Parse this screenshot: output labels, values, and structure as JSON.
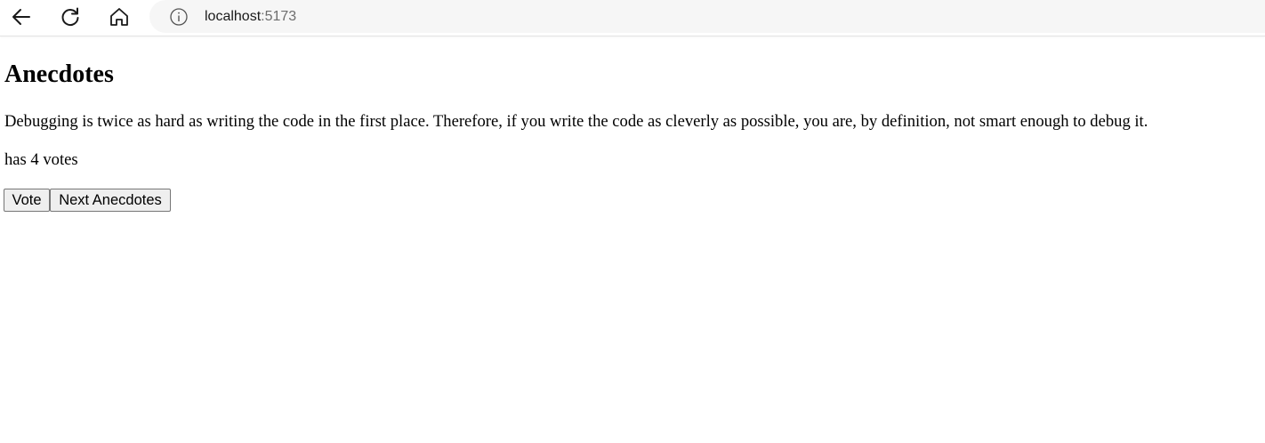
{
  "browser": {
    "back_icon": "back-arrow-icon",
    "reload_icon": "reload-icon",
    "home_icon": "home-icon",
    "info_icon": "info-icon",
    "url_host": "localhost",
    "url_port": ":5173"
  },
  "app": {
    "title": "Anecdotes",
    "anecdote": "Debugging is twice as hard as writing the code in the first place. Therefore, if you write the code as cleverly as possible, you are, by definition, not smart enough to debug it.",
    "votes_text": "has 4 votes",
    "vote_count": 4,
    "buttons": {
      "vote_label": "Vote",
      "next_label": "Next Anecdotes"
    }
  }
}
